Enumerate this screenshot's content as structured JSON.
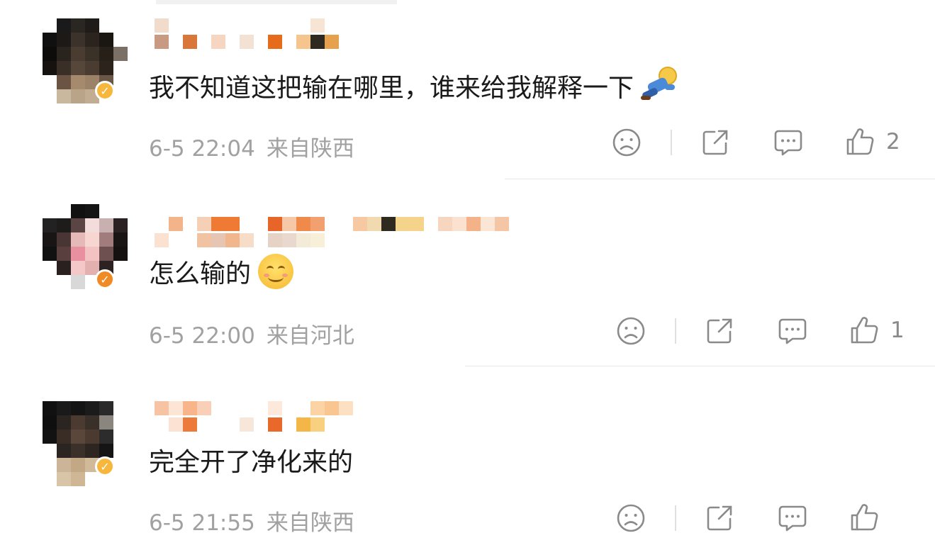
{
  "comments": [
    {
      "text": "我不知道这把输在哪里，谁来给我解释一下",
      "time": "6-5 22:04",
      "location": "来自陕西",
      "like_count": "2"
    },
    {
      "text": "怎么输的",
      "time": "6-5 22:00",
      "location": "来自河北",
      "like_count": "1"
    },
    {
      "text": "完全开了净化来的",
      "time": "6-5 21:55",
      "location": "来自陕西",
      "like_count": ""
    }
  ],
  "icons": {
    "dislike": "sad-face-icon",
    "share": "share-icon",
    "comment": "comment-icon",
    "like": "thumbs-up-icon",
    "verified": "verified-badge-icon"
  },
  "colors": {
    "meta_text": "#a1a1a1",
    "icon": "#8a8a8a",
    "badge_gold": "#f6b73c",
    "badge_orange": "#f08a24"
  }
}
